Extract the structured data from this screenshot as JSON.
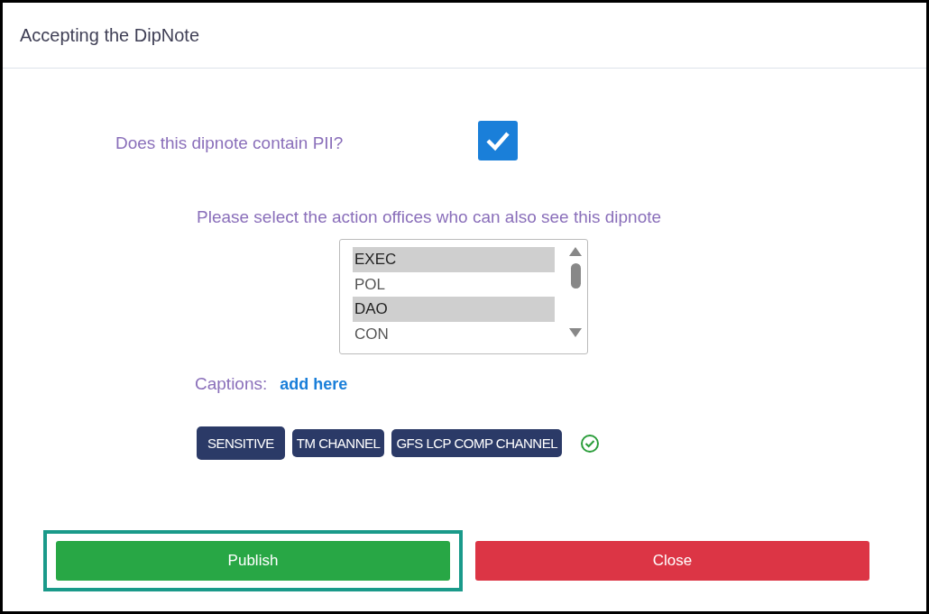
{
  "dialog": {
    "title": "Accepting the DipNote"
  },
  "pii": {
    "label": "Does this dipnote contain PII?",
    "checked": true
  },
  "offices": {
    "label": "Please select the action offices who can also see this dipnote",
    "items": [
      {
        "label": "EXEC",
        "selected": true
      },
      {
        "label": "POL",
        "selected": false
      },
      {
        "label": "DAO",
        "selected": true
      },
      {
        "label": "CON",
        "selected": false
      }
    ]
  },
  "captions": {
    "label": "Captions:",
    "link": "add here"
  },
  "tags": [
    {
      "label": "SENSITIVE",
      "selected": true
    },
    {
      "label": "TM CHANNEL",
      "selected": false
    },
    {
      "label": "GFS LCP COMP CHANNEL",
      "selected": false
    }
  ],
  "buttons": [
    {
      "label": "Publish",
      "kind": "primary",
      "highlighted": true
    },
    {
      "label": "Close",
      "kind": "danger",
      "highlighted": false
    }
  ]
}
